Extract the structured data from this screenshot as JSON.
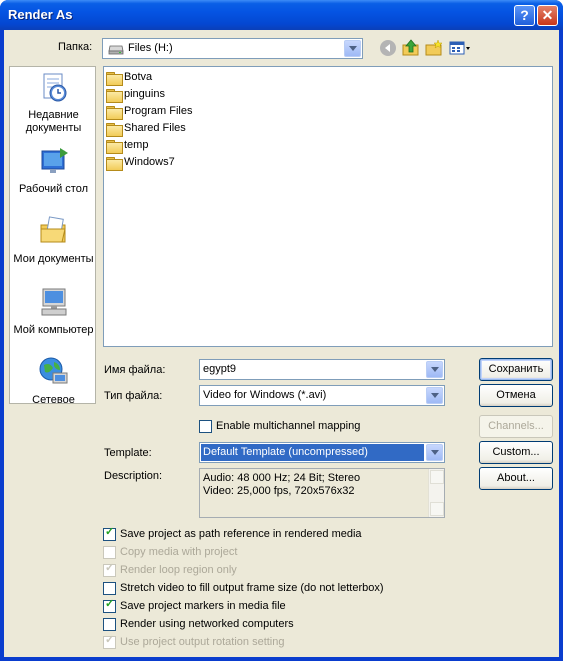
{
  "window": {
    "title": "Render As"
  },
  "location": {
    "label": "Папка:",
    "value": "Files (H:)"
  },
  "places": [
    {
      "label": "Недавние документы",
      "icon": "recent-documents-icon"
    },
    {
      "label": "Рабочий стол",
      "icon": "desktop-icon"
    },
    {
      "label": "Мои документы",
      "icon": "my-documents-icon"
    },
    {
      "label": "Мой компьютер",
      "icon": "my-computer-icon"
    },
    {
      "label": "Сетевое",
      "icon": "network-icon"
    }
  ],
  "files": [
    "Botva",
    "pinguins",
    "Program Files",
    "Shared Files",
    "temp",
    "Windows7"
  ],
  "filename": {
    "label": "Имя файла:",
    "value": "egypt9"
  },
  "filetype": {
    "label": "Тип файла:",
    "value": "Video for Windows (*.avi)"
  },
  "buttons": {
    "save": "Сохранить",
    "cancel": "Отмена",
    "channels": "Channels...",
    "custom": "Custom...",
    "about": "About..."
  },
  "multichannel": {
    "label": "Enable multichannel mapping",
    "checked": false
  },
  "template": {
    "label": "Template:",
    "value": "Default Template (uncompressed)"
  },
  "description": {
    "label": "Description:",
    "lines": [
      "Audio: 48 000 Hz; 24 Bit; Stereo",
      "Video: 25,000 fps, 720x576x32"
    ]
  },
  "options": [
    {
      "label": "Save project as path reference in rendered media",
      "checked": true,
      "enabled": true
    },
    {
      "label": "Copy media with project",
      "checked": false,
      "enabled": false
    },
    {
      "label": "Render loop region only",
      "checked": true,
      "enabled": false
    },
    {
      "label": "Stretch video to fill output frame size (do not letterbox)",
      "checked": false,
      "enabled": true
    },
    {
      "label": "Save project markers in media file",
      "checked": true,
      "enabled": true
    },
    {
      "label": "Render using networked computers",
      "checked": false,
      "enabled": true
    },
    {
      "label": "Use project output rotation setting",
      "checked": true,
      "enabled": false
    }
  ],
  "colors": {
    "title_bar": "#0554e3",
    "dialog_bg": "#ece9d8",
    "selection": "#316ac5"
  }
}
